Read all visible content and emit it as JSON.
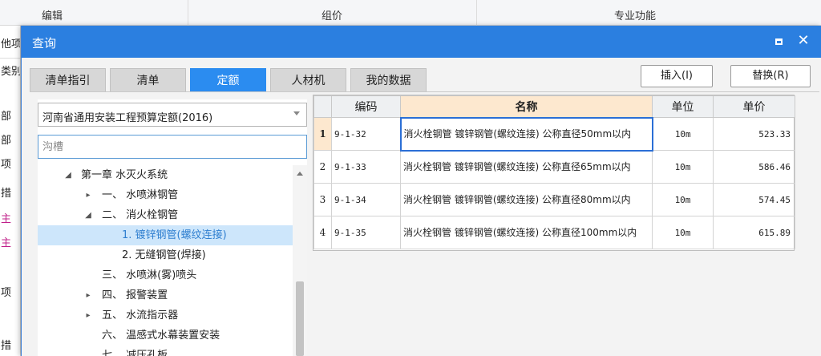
{
  "background": {
    "toolbar_groups": [
      "编辑",
      "组价",
      "专业功能"
    ],
    "left_cells": [
      "他项",
      "类别",
      "部",
      "部",
      "项",
      "措",
      "主",
      "主",
      "项",
      "措"
    ]
  },
  "dialog": {
    "title": "查询",
    "tabs": [
      {
        "label": "清单指引"
      },
      {
        "label": "清单"
      },
      {
        "label": "定额",
        "active": true
      },
      {
        "label": "人材机"
      },
      {
        "label": "我的数据"
      }
    ],
    "insert_label": "插入(I)",
    "replace_label": "替换(R)",
    "quota_library": "河南省通用安装工程预算定额(2016)",
    "search_placeholder": "沟槽",
    "tree": [
      {
        "toggle": "◢",
        "label": "第一章 水灭火系统"
      },
      {
        "toggle": "▸",
        "label": "一、 水喷淋钢管"
      },
      {
        "toggle": "◢",
        "label": "二、 消火栓钢管"
      },
      {
        "toggle": "",
        "label": "1. 镀锌钢管(螺纹连接)",
        "selected": true
      },
      {
        "toggle": "",
        "label": "2. 无缝钢管(焊接)"
      },
      {
        "toggle": "",
        "label": "三、 水喷淋(雾)喷头"
      },
      {
        "toggle": "▸",
        "label": "四、 报警装置"
      },
      {
        "toggle": "▸",
        "label": "五、 水流指示器"
      },
      {
        "toggle": "",
        "label": "六、 温感式水幕装置安装"
      },
      {
        "toggle": "",
        "label": "七、 减压孔板"
      }
    ],
    "grid": {
      "columns": [
        "",
        "编码",
        "名称",
        "单位",
        "单价"
      ],
      "rows": [
        {
          "index": "1",
          "code": "9-1-32",
          "name": "消火栓钢管 镀锌钢管(螺纹连接) 公称直径50mm以内",
          "unit": "10m",
          "price": "523.33"
        },
        {
          "index": "2",
          "code": "9-1-33",
          "name": "消火栓钢管 镀锌钢管(螺纹连接) 公称直径65mm以内",
          "unit": "10m",
          "price": "586.46"
        },
        {
          "index": "3",
          "code": "9-1-34",
          "name": "消火栓钢管 镀锌钢管(螺纹连接) 公称直径80mm以内",
          "unit": "10m",
          "price": "574.45"
        },
        {
          "index": "4",
          "code": "9-1-35",
          "name": "消火栓钢管 镀锌钢管(螺纹连接) 公称直径100mm以内",
          "unit": "10m",
          "price": "615.89"
        }
      ]
    }
  },
  "colors": {
    "titlebar": "#2b7fe0",
    "active_tab": "#2b8cf0",
    "selected_tree": "#cde6fb",
    "header_highlight": "#fde8cf"
  }
}
